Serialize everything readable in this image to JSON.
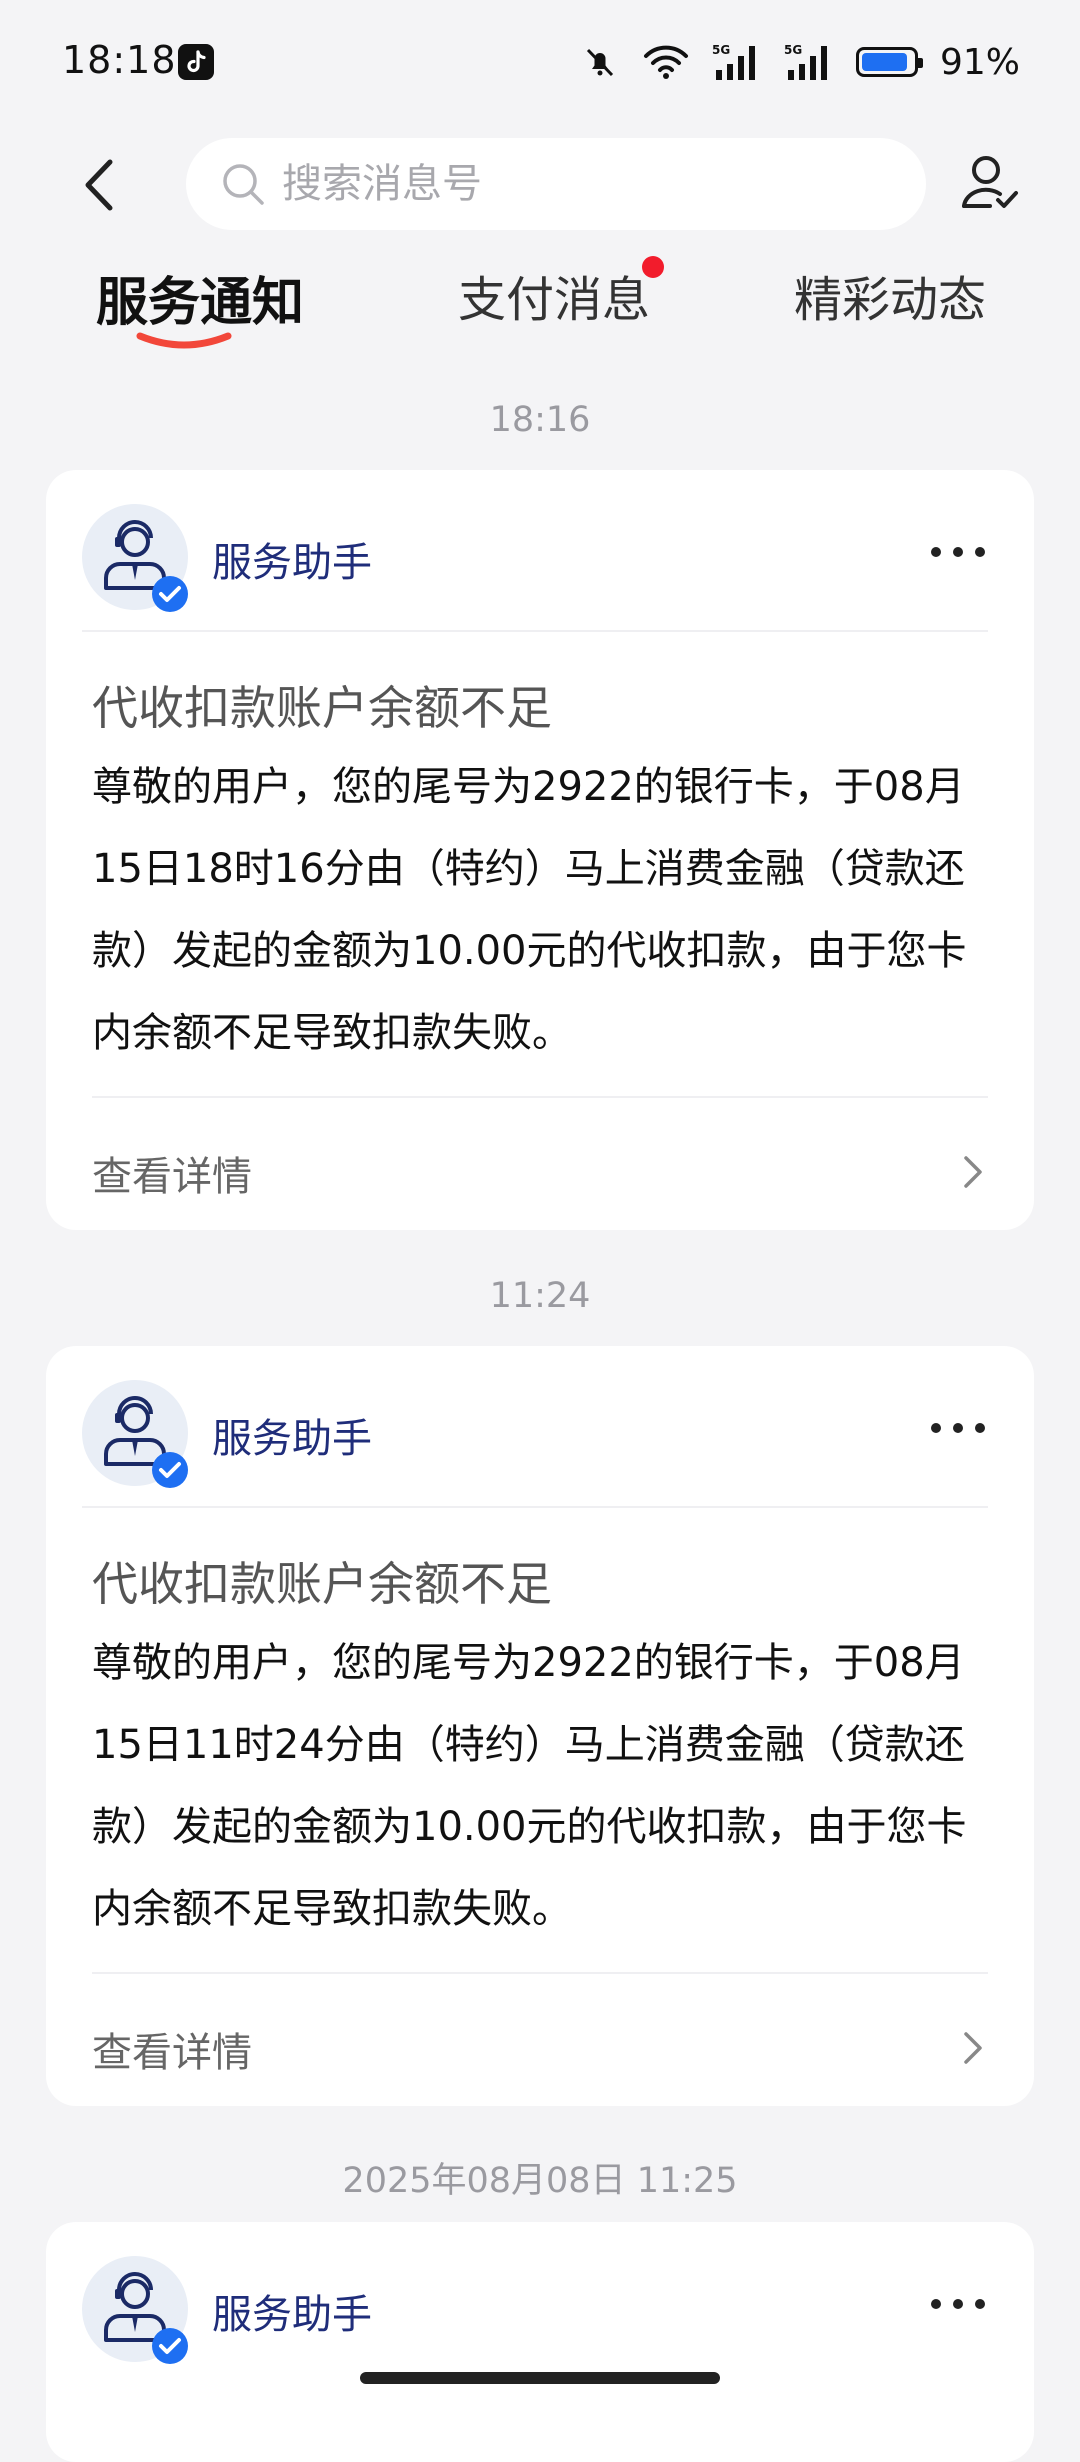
{
  "status_bar": {
    "time": "18:18",
    "battery_percent": "91%",
    "battery_level": 0.91
  },
  "search": {
    "placeholder": "搜索消息号"
  },
  "tabs": [
    {
      "label": "服务通知",
      "active": true,
      "unread_dot": false
    },
    {
      "label": "支付消息",
      "active": false,
      "unread_dot": true
    },
    {
      "label": "精彩动态",
      "active": false,
      "unread_dot": false
    }
  ],
  "colors": {
    "accent_red": "#f21c2c",
    "sender_blue": "#1f2d7a",
    "verified_blue": "#1e6ff2"
  },
  "messages": [
    {
      "time": "18:16",
      "sender": "服务助手",
      "title": "代收扣款账户余额不足",
      "body": "尊敬的用户，您的尾号为2922的银行卡，于08月15日18时16分由（特约）马上消费金融（贷款还款）发起的金额为10.00元的代收扣款，由于您卡内余额不足导致扣款失败。",
      "detail_label": "查看详情"
    },
    {
      "time": "11:24",
      "sender": "服务助手",
      "title": "代收扣款账户余额不足",
      "body": "尊敬的用户，您的尾号为2922的银行卡，于08月15日11时24分由（特约）马上消费金融（贷款还款）发起的金额为10.00元的代收扣款，由于您卡内余额不足导致扣款失败。",
      "detail_label": "查看详情"
    },
    {
      "time": "2025年08月08日 11:25",
      "sender": "服务助手"
    }
  ]
}
